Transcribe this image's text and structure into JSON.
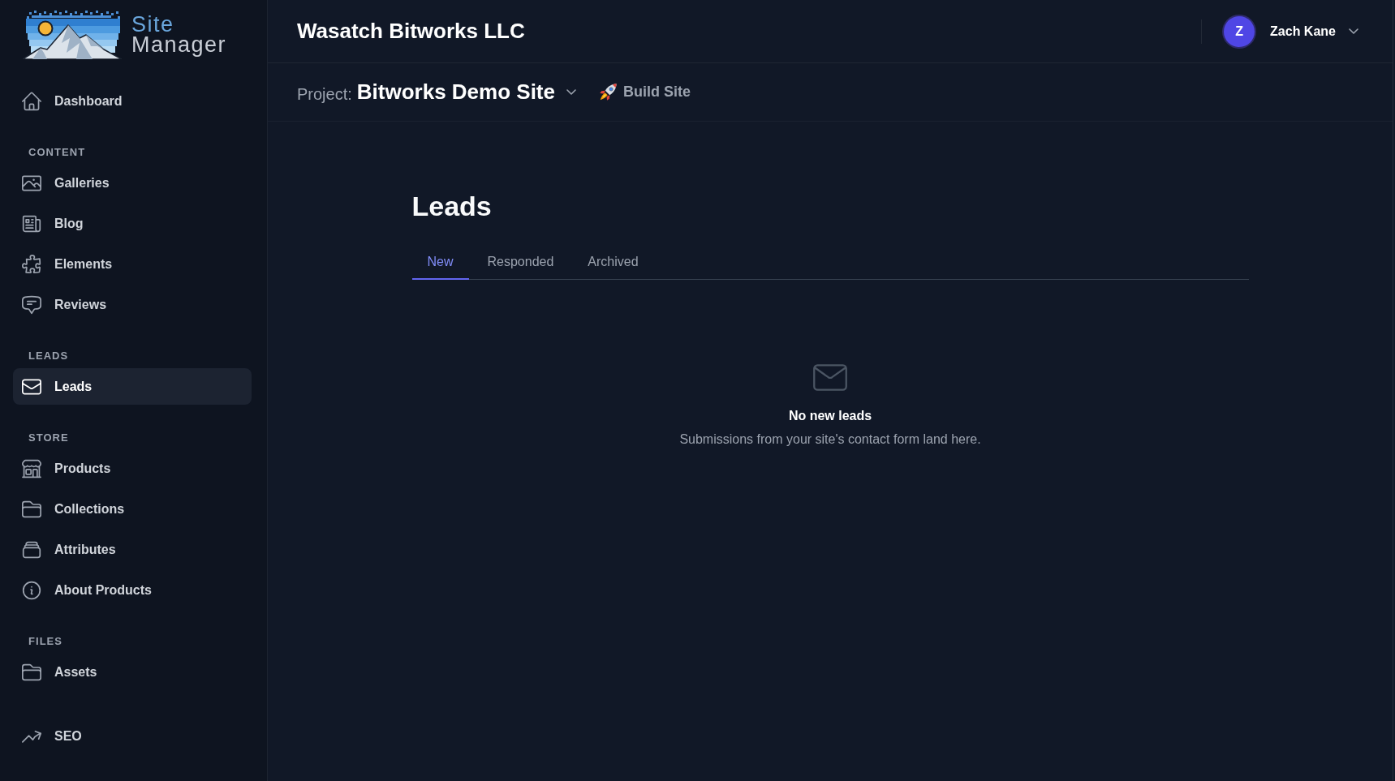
{
  "sidebar": {
    "brand": {
      "lines": [
        "Site",
        "Manager"
      ]
    },
    "sections": [
      {
        "items": [
          {
            "label": "Dashboard",
            "selected": false
          }
        ]
      },
      {
        "heading": "CONTENT",
        "items": [
          {
            "label": "Galleries",
            "selected": false
          },
          {
            "label": "Blog",
            "selected": false
          },
          {
            "label": "Elements",
            "selected": false
          },
          {
            "label": "Reviews",
            "selected": false
          }
        ]
      },
      {
        "heading": "LEADS",
        "items": [
          {
            "label": "Leads",
            "selected": true
          }
        ]
      },
      {
        "heading": "STORE",
        "items": [
          {
            "label": "Products",
            "selected": false
          },
          {
            "label": "Collections",
            "selected": false
          },
          {
            "label": "Attributes",
            "selected": false
          },
          {
            "label": "About Products",
            "selected": false
          }
        ]
      },
      {
        "heading": "FILES",
        "items": [
          {
            "label": "Assets",
            "selected": false
          }
        ]
      },
      {
        "items": [
          {
            "label": "SEO",
            "selected": false
          }
        ]
      }
    ]
  },
  "top_bar": {
    "title": "Wasatch Bitworks LLC",
    "user": {
      "initial": "Z",
      "name": "Zach Kane"
    }
  },
  "project_bar": {
    "label": "Project:",
    "project": "Bitworks Demo Site",
    "action": "Build Site"
  },
  "page": {
    "title": "Leads",
    "tabs": [
      {
        "label": "New",
        "selected": true
      },
      {
        "label": "Responded",
        "selected": false
      },
      {
        "label": "Archived",
        "selected": false
      }
    ],
    "empty_state": {
      "title": "No new leads",
      "text": "Submissions from your site's contact form land here."
    }
  }
}
